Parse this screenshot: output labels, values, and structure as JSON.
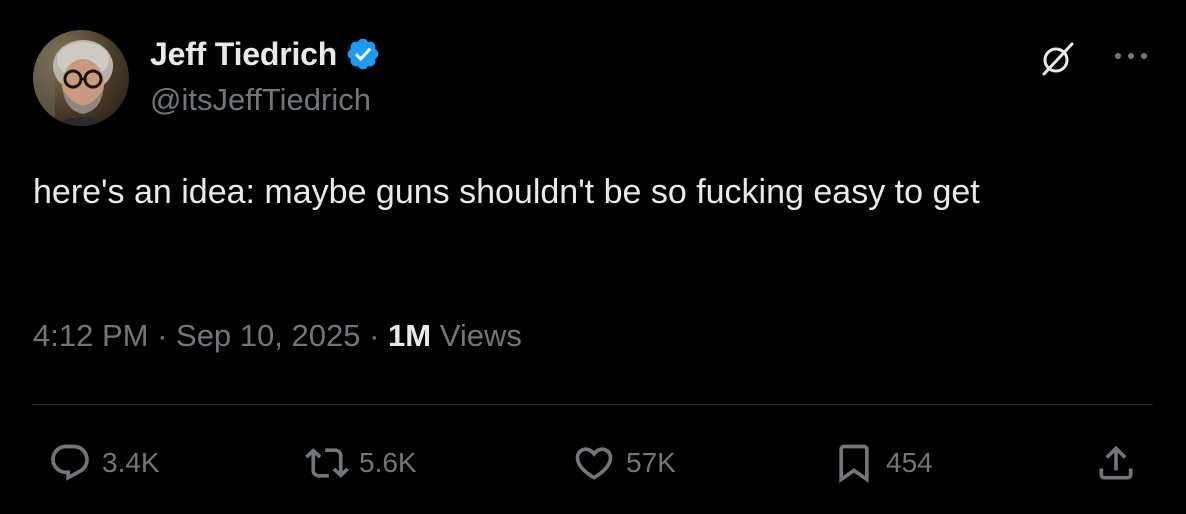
{
  "author": {
    "display_name": "Jeff Tiedrich",
    "handle": "@itsJeffTiedrich",
    "verified": true
  },
  "tweet": {
    "text": "here's an idea: maybe guns shouldn't be so fucking easy to get",
    "time": "4:12 PM",
    "date": "Sep 10, 2025",
    "views_count": "1M",
    "views_label": "Views"
  },
  "actions": {
    "replies": "3.4K",
    "reposts": "5.6K",
    "likes": "57K",
    "bookmarks": "454"
  },
  "icons": {
    "grok": "grok-icon",
    "more": "more-icon",
    "reply": "reply-icon",
    "repost": "repost-icon",
    "like": "heart-icon",
    "bookmark": "bookmark-icon",
    "share": "share-icon",
    "verified": "verified-badge-icon"
  },
  "colors": {
    "background": "#000000",
    "text": "#e7e9ea",
    "secondary": "#71767b",
    "verified": "#1d9bf0",
    "divider": "#2f3336"
  }
}
